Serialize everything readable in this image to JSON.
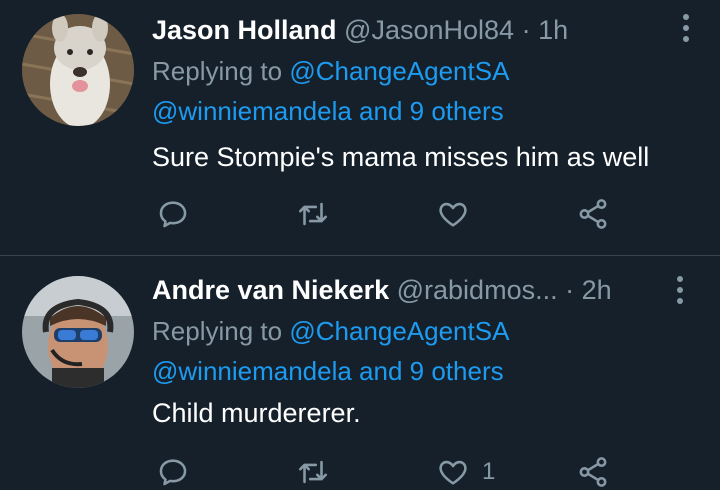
{
  "tweets": [
    {
      "name": "Jason Holland",
      "handle": "@JasonHol84",
      "dot": "·",
      "time": "1h",
      "replying_prefix": "Replying to",
      "reply_to_1": "@ChangeAgentSA",
      "reply_to_2": "@winniemandela and 9 others",
      "text": "Sure Stompie's mama misses him as well",
      "like_count": ""
    },
    {
      "name": "Andre van Niekerk",
      "handle": "@rabidmos...",
      "dot": "·",
      "time": "2h",
      "replying_prefix": "Replying to",
      "reply_to_1": "@ChangeAgentSA",
      "reply_to_2": "@winniemandela and 9 others",
      "text": "Child murdererer.",
      "like_count": "1"
    }
  ],
  "colors": {
    "background": "#15202b",
    "link": "#1d9bf0",
    "muted": "#8899a6",
    "divider": "#38444d"
  },
  "icons": [
    "reply-icon",
    "retweet-icon",
    "like-icon",
    "share-icon",
    "more-options-icon"
  ]
}
